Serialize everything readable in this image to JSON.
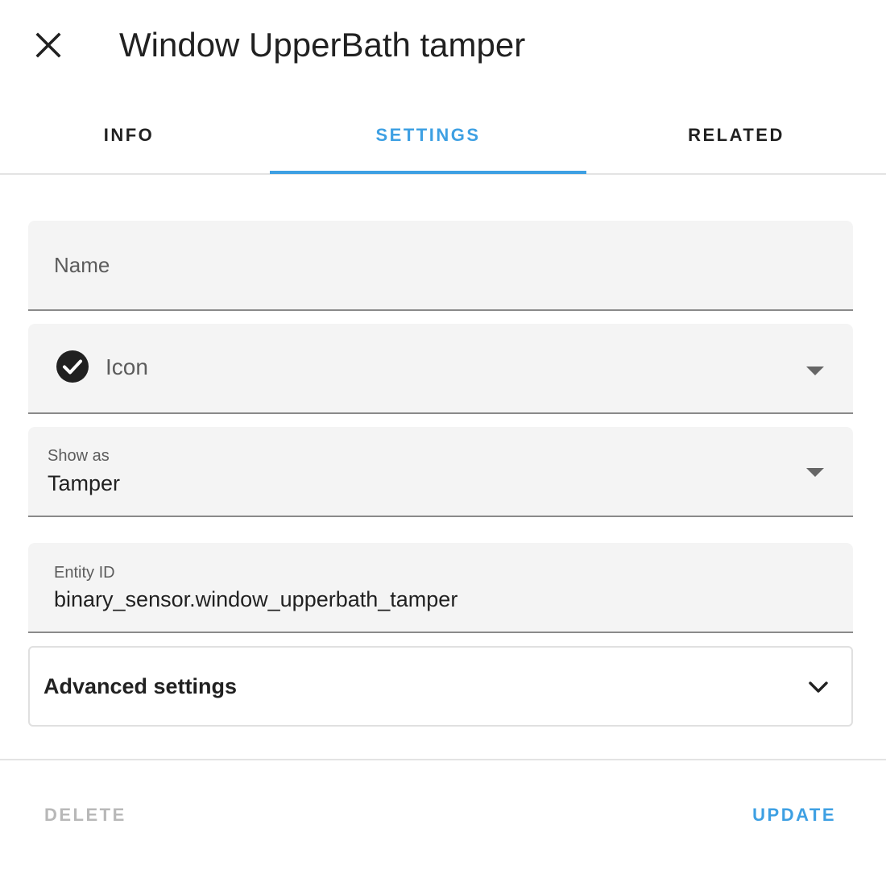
{
  "dialog": {
    "title": "Window UpperBath tamper"
  },
  "tabs": [
    {
      "label": "INFO",
      "active": false
    },
    {
      "label": "SETTINGS",
      "active": true
    },
    {
      "label": "RELATED",
      "active": false
    }
  ],
  "form": {
    "name": {
      "placeholder": "Name",
      "value": ""
    },
    "icon": {
      "label": "Icon",
      "icon": "check-circle-icon"
    },
    "show_as": {
      "label": "Show as",
      "value": "Tamper"
    },
    "entity_id": {
      "label": "Entity ID",
      "value": "binary_sensor.window_upperbath_tamper"
    }
  },
  "advanced": {
    "label": "Advanced settings"
  },
  "footer": {
    "delete_label": "DELETE",
    "update_label": "UPDATE"
  },
  "colors": {
    "accent": "#3ea0e3",
    "disabled": "#b8b8b8",
    "field_bg": "#f4f4f4"
  }
}
